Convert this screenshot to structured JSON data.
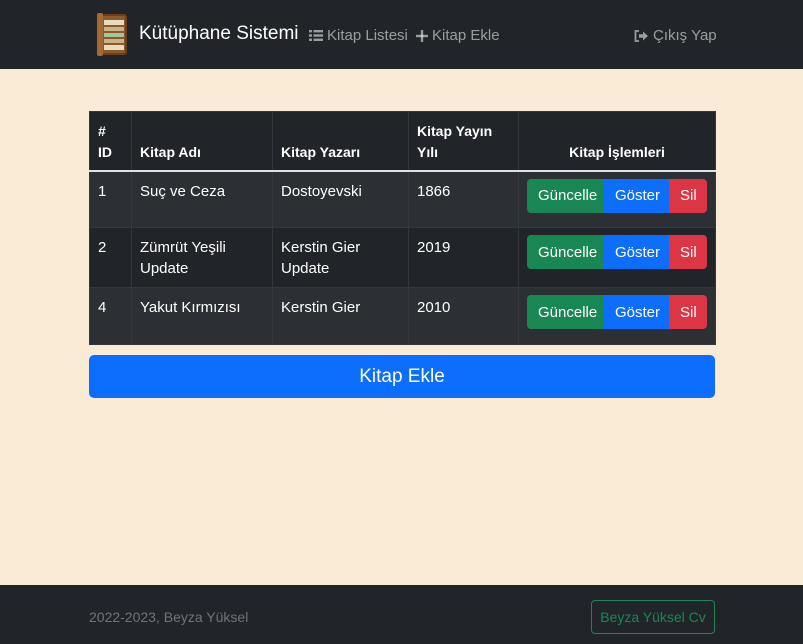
{
  "navbar": {
    "brand": "Kütüphane Sistemi",
    "links": {
      "list": "Kitap Listesi",
      "add": "Kitap Ekle",
      "logout": "Çıkış Yap"
    }
  },
  "table": {
    "headers": {
      "hash": "#",
      "id": "ID",
      "name": "Kitap Adı",
      "author": "Kitap Yazarı",
      "year_1": "Kitap Yayın",
      "year_2": "Yılı",
      "ops": "Kitap İşlemleri"
    },
    "rows": [
      {
        "id": "1",
        "name": "Suç ve Ceza",
        "author": "Dostoyevski",
        "year": "1866"
      },
      {
        "id": "2",
        "name": "Zümrüt Yeşili Update",
        "author": "Kerstin Gier Update",
        "year": "2019"
      },
      {
        "id": "4",
        "name": "Yakut Kırmızısı",
        "author": "Kerstin Gier",
        "year": "2010"
      }
    ],
    "actions": {
      "update": "Güncelle",
      "show": "Göster",
      "delete": "Sil"
    }
  },
  "add_button": "Kitap Ekle",
  "footer": {
    "copyright": "2022-2023, Beyza Yüksel",
    "cv_button": "Beyza Yüksel Cv"
  },
  "colors": {
    "background": "#faebd7",
    "dark": "#212529",
    "primary": "#0d6efd",
    "success": "#198754",
    "danger": "#dc3545"
  }
}
